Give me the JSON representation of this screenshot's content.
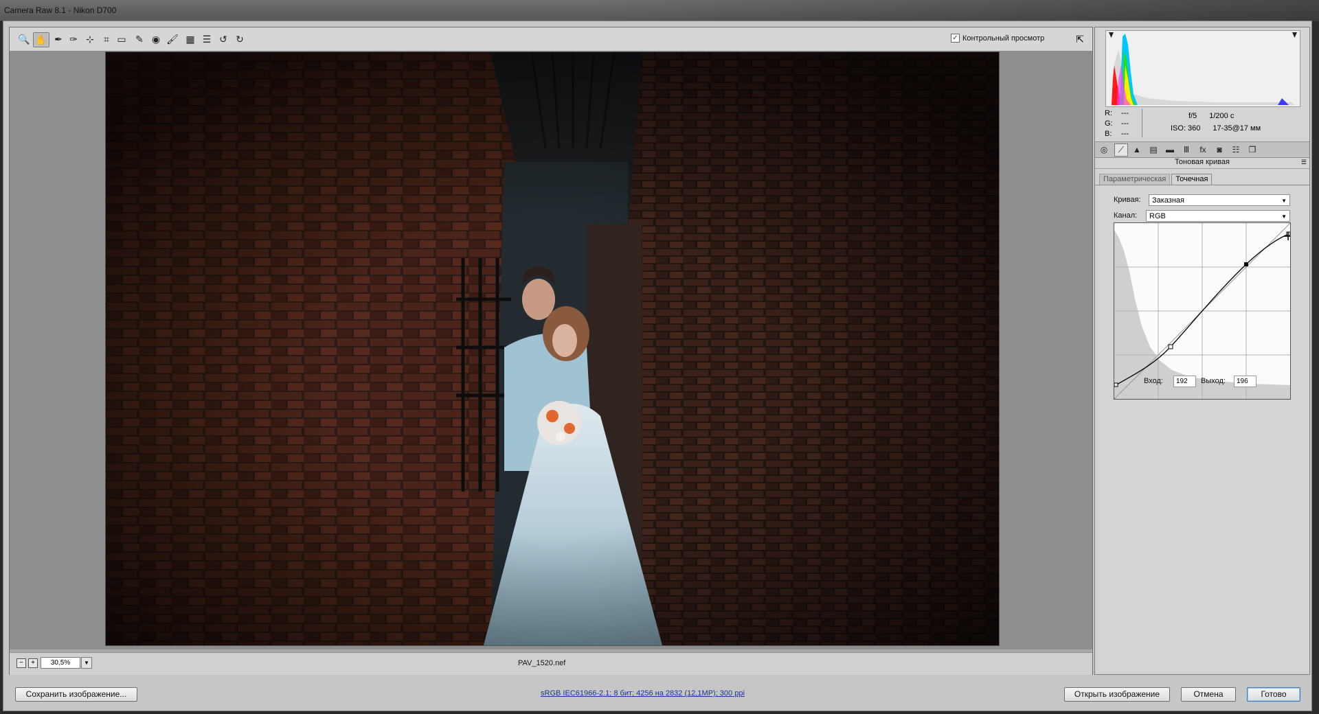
{
  "window": {
    "title": "Camera Raw 8.1  -  Nikon D700"
  },
  "toolbar": {
    "tools": [
      {
        "name": "zoom-tool-icon",
        "glyph": "🔍"
      },
      {
        "name": "hand-tool-icon",
        "glyph": "✋"
      },
      {
        "name": "white-balance-tool-icon",
        "glyph": "✒"
      },
      {
        "name": "color-sampler-tool-icon",
        "glyph": "✑"
      },
      {
        "name": "targeted-adjustment-tool-icon",
        "glyph": "⊹"
      },
      {
        "name": "crop-tool-icon",
        "glyph": "⌗"
      },
      {
        "name": "straighten-tool-icon",
        "glyph": "▭"
      },
      {
        "name": "spot-removal-tool-icon",
        "glyph": "✎"
      },
      {
        "name": "red-eye-tool-icon",
        "glyph": "◉"
      },
      {
        "name": "adjustment-brush-icon",
        "glyph": "🖌"
      },
      {
        "name": "graduated-filter-icon",
        "glyph": "▦"
      },
      {
        "name": "radial-filter-icon",
        "glyph": "☰"
      },
      {
        "name": "rotate-ccw-icon",
        "glyph": "↺"
      },
      {
        "name": "rotate-cw-icon",
        "glyph": "↻"
      }
    ],
    "preview_label": "Контрольный просмотр",
    "preview_checked": true
  },
  "status": {
    "zoom": "30,5%",
    "filename": "PAV_1520.nef"
  },
  "histogram": {
    "r": "---",
    "g": "---",
    "b": "---",
    "aperture": "f/5",
    "shutter": "1/200 с",
    "iso": "ISO: 360",
    "lens": "17-35@17 мм"
  },
  "panel": {
    "title": "Тоновая кривая",
    "tabs": [
      "Параметрическая",
      "Точечная"
    ],
    "active_tab": 1,
    "curve_label": "Кривая:",
    "curve_value": "Заказная",
    "channel_label": "Канал:",
    "channel_value": "RGB",
    "input_label": "Вход:",
    "input_value": "192",
    "output_label": "Выход:",
    "output_value": "196"
  },
  "bottom": {
    "save_label": "Сохранить изображение...",
    "workflow_link": "sRGB IEC61966-2.1; 8 бит; 4256 на 2832 (12,1МР); 300 ppi",
    "open_label": "Открыть изображение",
    "cancel_label": "Отмена",
    "done_label": "Готово"
  }
}
